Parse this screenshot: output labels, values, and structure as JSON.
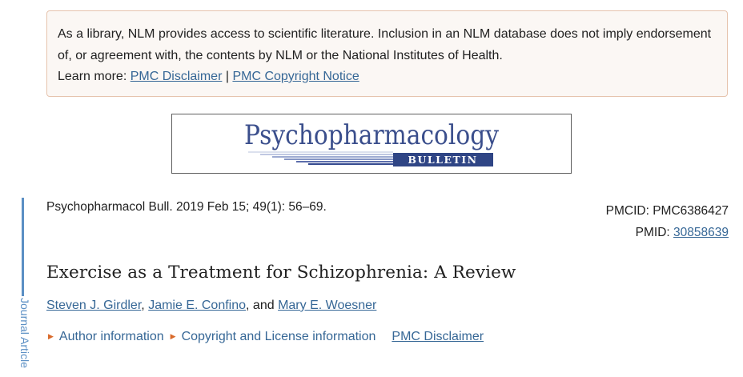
{
  "disclaimer": {
    "text": "As a library, NLM provides access to scientific literature. Inclusion in an NLM database does not imply endorsement of, or agreement with, the contents by NLM or the National Institutes of Health.",
    "learn_more_label": "Learn more:",
    "link_disclaimer": "PMC Disclaimer",
    "separator": "|",
    "link_copyright": "PMC Copyright Notice"
  },
  "journal_banner": {
    "title": "Psychopharmacology",
    "subtitle": "BULLETIN",
    "title_color": "#3a4e8c",
    "band_color": "#2f4585"
  },
  "side_tab": {
    "label": "Journal Article",
    "color": "#5b8fc4"
  },
  "citation": {
    "text": "Psychopharmacol Bull. 2019 Feb 15; 49(1): 56–69."
  },
  "ids": {
    "pmcid_label": "PMCID:",
    "pmcid_value": "PMC6386427",
    "pmid_label": "PMID:",
    "pmid_value": "30858639"
  },
  "article": {
    "title": "Exercise as a Treatment for Schizophrenia: A Review",
    "authors": [
      "Steven J. Girdler",
      "Jamie E. Confino",
      "Mary E. Woesner"
    ],
    "author_sep_1": ",",
    "author_sep_2": ", and"
  },
  "info_links": {
    "author_information": "Author information",
    "copyright_license": "Copyright and License information",
    "pmc_disclaimer": "PMC Disclaimer",
    "expand_icon": "triangle-right-icon"
  },
  "colors": {
    "link": "#366796",
    "disclaimer_border": "#e6c3ad",
    "disclaimer_bg": "#fbf7f4",
    "accent_orange": "#d96a2b"
  }
}
